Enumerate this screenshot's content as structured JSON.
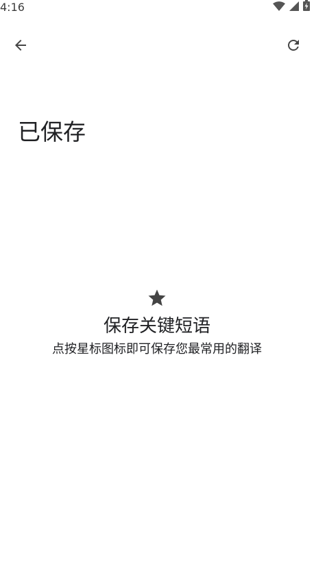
{
  "status_bar": {
    "time": "4:16",
    "icons": [
      "wifi-icon",
      "signal-icon",
      "battery-charging-icon"
    ]
  },
  "app_bar": {
    "back_icon": "arrow-back-icon",
    "refresh_icon": "refresh-icon"
  },
  "page": {
    "title": "已保存"
  },
  "empty_state": {
    "icon": "star-icon",
    "title": "保存关键短语",
    "subtitle": "点按星标图标即可保存您最常用的翻译"
  },
  "colors": {
    "text": "#202124",
    "icon": "#444444",
    "background": "#ffffff"
  }
}
